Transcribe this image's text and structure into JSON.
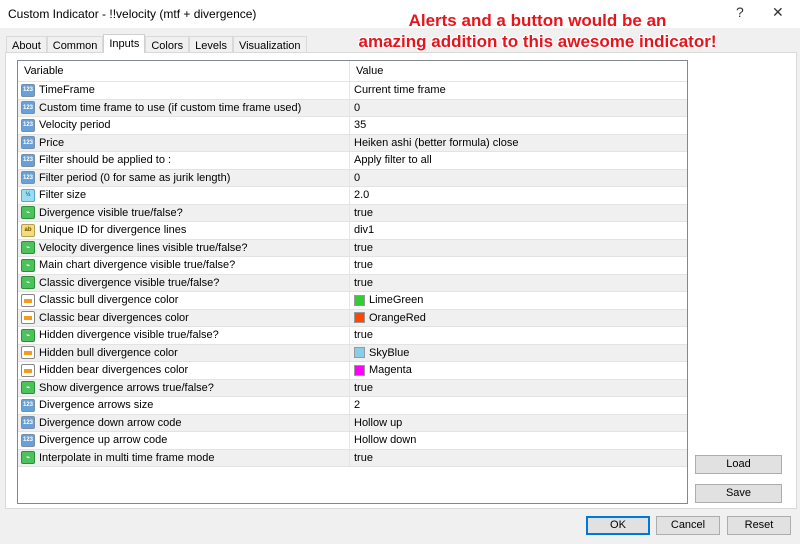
{
  "window": {
    "title": "Custom Indicator - !!velocity (mtf + divergence)",
    "help": "?",
    "close": "✕"
  },
  "annotation": {
    "line1": "Alerts and a button would be an",
    "line2": "amazing addition to this awesome indicator!"
  },
  "tabs": [
    {
      "label": "About"
    },
    {
      "label": "Common"
    },
    {
      "label": "Inputs",
      "active": true
    },
    {
      "label": "Colors"
    },
    {
      "label": "Levels"
    },
    {
      "label": "Visualization"
    }
  ],
  "table": {
    "headers": {
      "variable": "Variable",
      "value": "Value"
    },
    "rows": [
      {
        "icon": "num",
        "icon_text": "123",
        "variable": "TimeFrame",
        "value": "Current time frame"
      },
      {
        "icon": "num",
        "icon_text": "123",
        "variable": "Custom time frame to use (if custom time frame used)",
        "value": "0"
      },
      {
        "icon": "num",
        "icon_text": "123",
        "variable": "Velocity period",
        "value": "35"
      },
      {
        "icon": "num",
        "icon_text": "123",
        "variable": "Price",
        "value": "Heiken ashi (better formula) close"
      },
      {
        "icon": "num",
        "icon_text": "123",
        "variable": "Filter should be applied to :",
        "value": "Apply filter to all"
      },
      {
        "icon": "num",
        "icon_text": "123",
        "variable": "Filter period (0 for same as jurik length)",
        "value": "0"
      },
      {
        "icon": "half",
        "icon_text": "½",
        "variable": "Filter size",
        "value": "2.0"
      },
      {
        "icon": "bool",
        "icon_text": "⌁",
        "variable": "Divergence visible true/false?",
        "value": "true"
      },
      {
        "icon": "str",
        "icon_text": "ab",
        "variable": "Unique ID for divergence lines",
        "value": "div1"
      },
      {
        "icon": "bool",
        "icon_text": "⌁",
        "variable": "Velocity divergence lines visible true/false?",
        "value": "true"
      },
      {
        "icon": "bool",
        "icon_text": "⌁",
        "variable": "Main chart divergence visible true/false?",
        "value": "true"
      },
      {
        "icon": "bool",
        "icon_text": "⌁",
        "variable": "Classic divergence visible true/false?",
        "value": "true"
      },
      {
        "icon": "color",
        "icon_text": "",
        "variable": "Classic bull divergence color",
        "value": "LimeGreen",
        "swatch": "#32cd32"
      },
      {
        "icon": "color",
        "icon_text": "",
        "variable": "Classic bear divergences color",
        "value": "OrangeRed",
        "swatch": "#ff4500"
      },
      {
        "icon": "bool",
        "icon_text": "⌁",
        "variable": "Hidden divergence visible true/false?",
        "value": "true"
      },
      {
        "icon": "color",
        "icon_text": "",
        "variable": "Hidden bull divergence color",
        "value": "SkyBlue",
        "swatch": "#87ceeb"
      },
      {
        "icon": "color",
        "icon_text": "",
        "variable": "Hidden bear divergences color",
        "value": "Magenta",
        "swatch": "#ff00ff"
      },
      {
        "icon": "bool",
        "icon_text": "⌁",
        "variable": "Show divergence arrows true/false?",
        "value": "true"
      },
      {
        "icon": "num",
        "icon_text": "123",
        "variable": "Divergence arrows size",
        "value": "2"
      },
      {
        "icon": "num",
        "icon_text": "123",
        "variable": "Divergence down arrow code",
        "value": "Hollow up"
      },
      {
        "icon": "num",
        "icon_text": "123",
        "variable": "Divergence up arrow code",
        "value": "Hollow down"
      },
      {
        "icon": "bool",
        "icon_text": "⌁",
        "variable": "Interpolate in multi time frame mode",
        "value": "true"
      }
    ]
  },
  "buttons": {
    "load": "Load",
    "save": "Save",
    "ok": "OK",
    "cancel": "Cancel",
    "reset": "Reset"
  }
}
